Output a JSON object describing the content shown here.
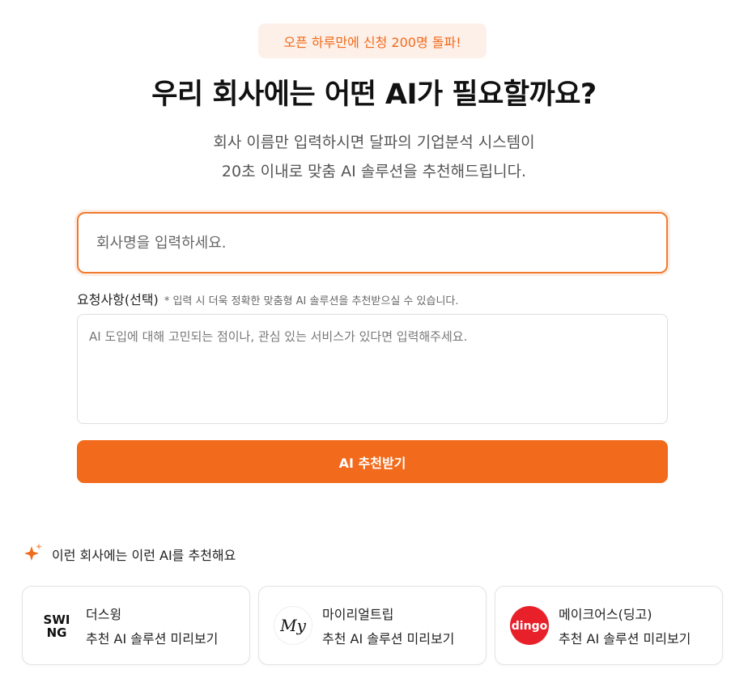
{
  "badge": "오픈 하루만에 신청 200명 돌파!",
  "headline": "우리 회사에는 어떤 AI가 필요할까요?",
  "subtitle_line1": "회사 이름만 입력하시면 달파의 기업분석 시스템이",
  "subtitle_line2": "20초 이내로 맞춤 AI 솔루션을 추천해드립니다.",
  "company_input": {
    "value": "",
    "placeholder": "회사명을 입력하세요."
  },
  "request": {
    "label": "요청사항(선택)",
    "hint": "* 입력 시 더욱 정확한 맞춤형 AI 솔루션을 추천받으실 수 있습니다.",
    "placeholder": "AI 도입에 대해 고민되는 점이나, 관심 있는 서비스가 있다면 입력해주세요."
  },
  "submit_label": "AI 추천받기",
  "section_title": "이런 회사에는 이런 AI를 추천해요",
  "cards": [
    {
      "name": "더스윙",
      "cta": "추천 AI 솔루션 미리보기",
      "logo_text": "SWING",
      "logo_color": "#111111"
    },
    {
      "name": "마이리얼트립",
      "cta": "추천 AI 솔루션 미리보기",
      "logo_text": "My",
      "logo_color": "#ffffff"
    },
    {
      "name": "메이크어스(딩고)",
      "cta": "추천 AI 솔루션 미리보기",
      "logo_text": "dingo",
      "logo_color": "#e8202a"
    }
  ],
  "colors": {
    "accent": "#f26a1b",
    "badge_bg": "#fdf0e8"
  }
}
